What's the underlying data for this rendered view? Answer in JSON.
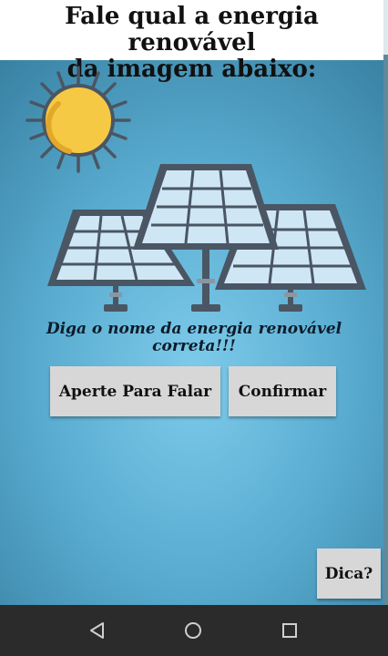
{
  "header": {
    "title": "Fale qual a energia renovável\nda imagem abaixo:"
  },
  "illustration": {
    "subject": "solar panels with sun",
    "colors": {
      "sun": "#f6c944",
      "panel": "#cfe6f5",
      "frame": "#4a5663"
    }
  },
  "prompt": {
    "text": "Diga o nome da energia renovável correta!!!"
  },
  "buttons": {
    "speak_label": "Aperte Para Falar",
    "confirm_label": "Confirmar",
    "hint_label": "Dica?"
  },
  "navbar": {
    "back_icon": "triangle-back-icon",
    "home_icon": "circle-home-icon",
    "recent_icon": "square-recent-icon"
  }
}
